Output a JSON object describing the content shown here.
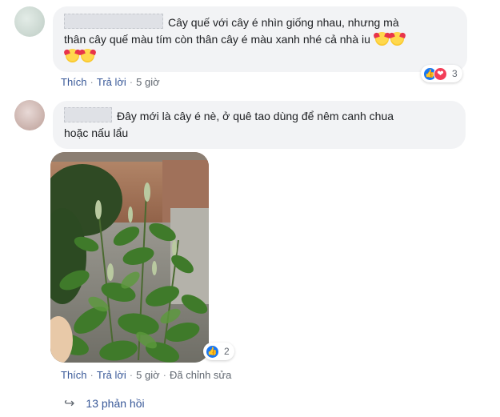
{
  "comments": [
    {
      "text_line1": "Cây quế với cây é nhìn giống nhau, nhưng mà",
      "text_line2": "thân cây quế màu tím còn thân cây é màu xanh nhé cả nhà iu",
      "actions": {
        "like": "Thích",
        "reply": "Trả lời",
        "time": "5 giờ"
      },
      "reaction_count": "3",
      "reaction_icons": [
        "like-icon",
        "love-icon"
      ]
    },
    {
      "text_line1": "Đây mới là cây é nè, ở quê tao dùng để nêm canh chua",
      "text_line2": "hoặc nấu lẩu",
      "actions": {
        "like": "Thích",
        "reply": "Trả lời",
        "time": "5 giờ",
        "edited": "Đã chỉnh sửa"
      },
      "reaction_count": "2",
      "reaction_icons": [
        "like-icon"
      ]
    }
  ],
  "replies": {
    "label": "13 phản hồi"
  },
  "colors": {
    "link": "#385898",
    "bubble": "#f2f3f5",
    "like": "#1877f2",
    "love": "#f33e58"
  }
}
